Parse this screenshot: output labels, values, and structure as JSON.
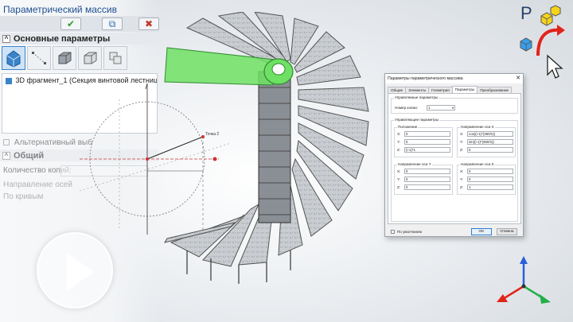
{
  "panel": {
    "title": "Параметрический массив",
    "toolbar": {
      "ok_glyph": "✔",
      "preview_glyph": "⧉",
      "cancel_glyph": "✖"
    },
    "section_main": "Основные параметры",
    "fragment_item": "3D фрагмент_1 (Секция винтовой лестницы",
    "alt_label": "Альтернативный выб",
    "section_general": "Общий",
    "copies_label": "Количество копий:",
    "direction_label": "Направление осей",
    "fill_label": "По кривым"
  },
  "sketch": {
    "point_label": "Точка 2"
  },
  "dialog": {
    "title": "Параметры параметрического массива",
    "close_glyph": "✕",
    "tabs": [
      "Общие",
      "Элементы",
      "Геометрия",
      "Параметры",
      "Преобразование"
    ],
    "active_tab": 3,
    "group_control": "Управляемые параметры",
    "copy_number_label": "Номер копии:",
    "copy_number_value": "1",
    "group_driving": "Управляющие параметры",
    "position": {
      "title": "Положение",
      "rows": [
        {
          "label": "X:",
          "value": "0"
        },
        {
          "label": "Y:",
          "value": "0"
        },
        {
          "label": "Z:",
          "value": "(i-1)*1"
        }
      ]
    },
    "axis_x": {
      "title": "Направление оси X",
      "rows": [
        {
          "label": "X:",
          "value": "cos((i-1)*(360/n))"
        },
        {
          "label": "Y:",
          "value": "sin((i-1)*(360/n))"
        },
        {
          "label": "Z:",
          "value": "0"
        }
      ]
    },
    "axis_y": {
      "title": "Направление оси Y",
      "rows": [
        {
          "label": "X:",
          "value": "0"
        },
        {
          "label": "Y:",
          "value": "0"
        },
        {
          "label": "Z:",
          "value": "0"
        }
      ]
    },
    "axis_z": {
      "title": "Направление оси Z",
      "rows": [
        {
          "label": "X:",
          "value": "0"
        },
        {
          "label": "Y:",
          "value": "0"
        },
        {
          "label": "Z:",
          "value": "1"
        }
      ]
    },
    "default_label": "По умолчанию",
    "ok_label": "OK",
    "cancel_label": "Отмена"
  },
  "logo": {
    "letter": "P"
  },
  "colors": {
    "accent": "#2f7fd1",
    "highlight": "#59d15a",
    "logo_yellow": "#f5d21c",
    "logo_blue": "#3a9ee8",
    "arrow_red": "#e2231a"
  }
}
